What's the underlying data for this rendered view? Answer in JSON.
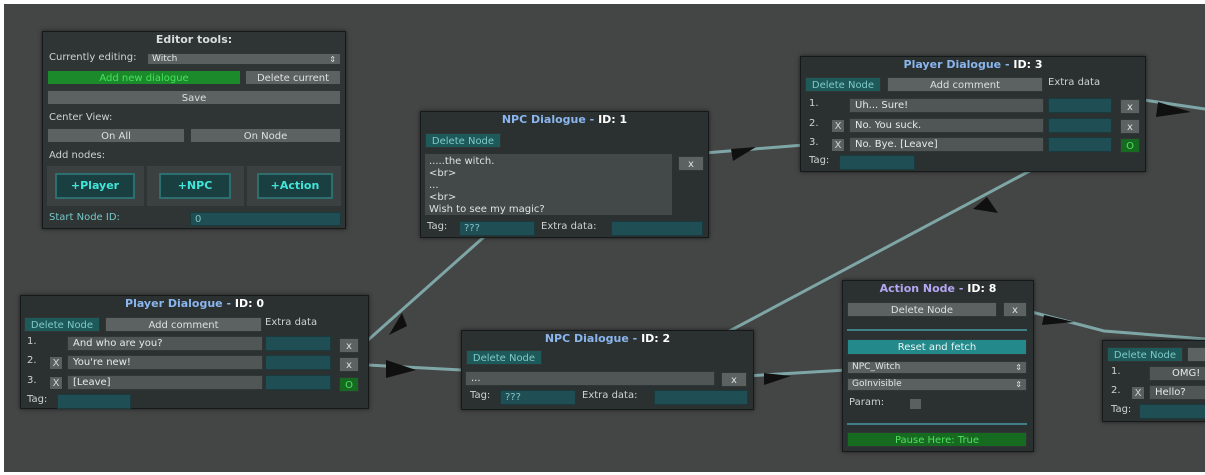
{
  "colors": {
    "canvas": "#444545",
    "wire": "#7fa6a6",
    "node_bg": "#2b3131",
    "accent_blue": "#8ab6ee",
    "green": "#1b8a2a",
    "teal": "#1e5a5a"
  },
  "editor": {
    "title": "Editor tools:",
    "currently_editing_label": "Currently editing:",
    "currently_editing_value": "Witch",
    "add_new_dialogue": "Add new dialogue",
    "delete_current": "Delete current",
    "save": "Save",
    "center_view_label": "Center View:",
    "on_all": "On All",
    "on_node": "On Node",
    "add_nodes_label": "Add nodes:",
    "add_player": "+Player",
    "add_npc": "+NPC",
    "add_action": "+Action",
    "start_node_label": "Start Node ID:",
    "start_node_value": "0"
  },
  "player0": {
    "title_prefix": "Player Dialogue",
    "title_sep": " - ",
    "title_id": "ID: 0",
    "delete_node": "Delete Node",
    "add_comment": "Add comment",
    "extra_data": "Extra data",
    "rows": [
      {
        "num": "1.",
        "text": "And who are you?",
        "x": "",
        "btn": "x"
      },
      {
        "num": "2.",
        "text": "You're new!",
        "x": "X",
        "btn": "x"
      },
      {
        "num": "3.",
        "text": "[Leave]",
        "x": "X",
        "btn": "O"
      }
    ],
    "tag_label": "Tag:"
  },
  "npc1": {
    "title_prefix": "NPC Dialogue",
    "title_sep": " - ",
    "title_id": "ID: 1",
    "delete_node": "Delete Node",
    "text": ".....the witch.\n<br>\n...\n<br>\nWish to see my magic?",
    "x": "x",
    "tag_label": "Tag:",
    "tag_value": "???",
    "extra_label": "Extra data:"
  },
  "npc2": {
    "title_prefix": "NPC Dialogue",
    "title_sep": " - ",
    "title_id": "ID: 2",
    "delete_node": "Delete Node",
    "text": "...",
    "x": "x",
    "tag_label": "Tag:",
    "tag_value": "???",
    "extra_label": "Extra data:"
  },
  "player3": {
    "title_prefix": "Player Dialogue",
    "title_sep": " - ",
    "title_id": "ID: 3",
    "delete_node": "Delete Node",
    "add_comment": "Add comment",
    "extra_data": "Extra data",
    "rows": [
      {
        "num": "1.",
        "text": "Uh... Sure!",
        "x": "",
        "btn": "x"
      },
      {
        "num": "2.",
        "text": "No. You suck.",
        "x": "X",
        "btn": "x"
      },
      {
        "num": "3.",
        "text": "No. Bye. [Leave]",
        "x": "X",
        "btn": "O"
      }
    ],
    "tag_label": "Tag:"
  },
  "action8": {
    "title_prefix": "Action Node",
    "title_sep": " - ",
    "title_id": "ID: 8",
    "delete_node": "Delete Node",
    "x": "x",
    "reset_fetch": "Reset and fetch",
    "target": "NPC_Witch",
    "method": "GoInvisible",
    "param_label": "Param:",
    "pause": "Pause Here: True"
  },
  "partial": {
    "delete_node": "Delete Node",
    "rows": [
      {
        "num": "1.",
        "text": "OMG!",
        "x": ""
      },
      {
        "num": "2.",
        "text": "Hello?",
        "x": "X"
      }
    ],
    "tag_label": "Tag:"
  }
}
